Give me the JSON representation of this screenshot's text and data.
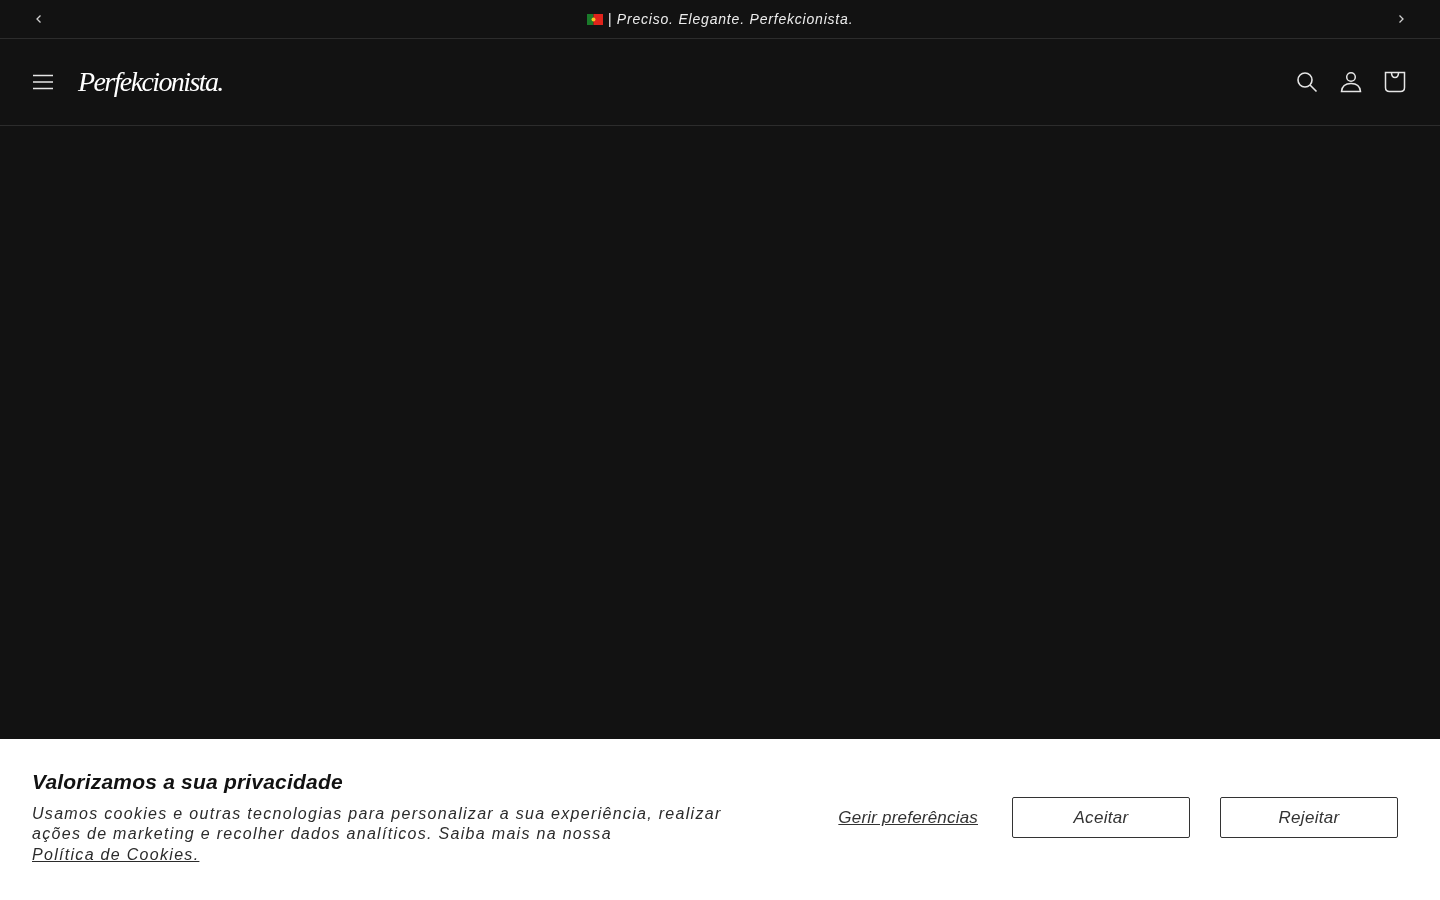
{
  "announcement_bar": {
    "text": "| Preciso. Elegante. Perfekcionista."
  },
  "header": {
    "logo": "Perfekcionista."
  },
  "cookie_banner": {
    "title": "Valorizamos a sua privacidade",
    "body": "Usamos cookies e outras tecnologias para personalizar a sua experiência, realizar ações de marketing e recolher dados analíticos. Saiba mais na nossa ",
    "policy_link": "Política de Cookies.",
    "manage_link": "Gerir preferências",
    "buttons": [
      {
        "label": "Aceitar"
      },
      {
        "label": "Rejeitar"
      }
    ]
  }
}
